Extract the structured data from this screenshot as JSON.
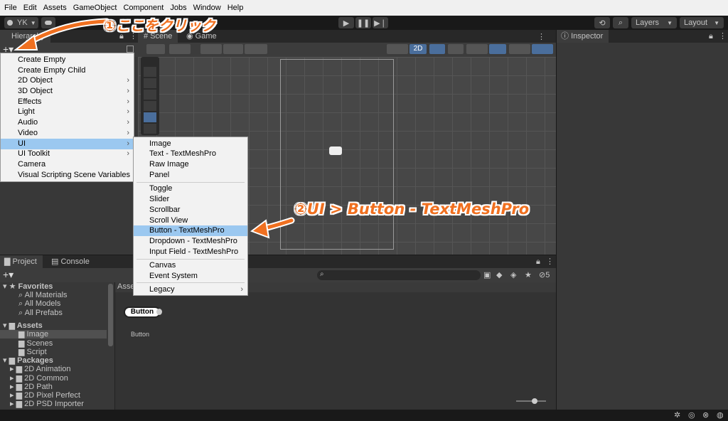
{
  "menubar": {
    "items": [
      "File",
      "Edit",
      "Assets",
      "GameObject",
      "Component",
      "Jobs",
      "Window",
      "Help"
    ]
  },
  "toolbar": {
    "account": "YK",
    "layers": "Layers",
    "layout": "Layout"
  },
  "hierarchy": {
    "tab": "Hierarchy"
  },
  "scene": {
    "tab_scene": "Scene",
    "tab_game": "Game",
    "mode_2d": "2D"
  },
  "inspector": {
    "tab": "Inspector"
  },
  "create_menu": {
    "items": [
      {
        "label": "Create Empty",
        "submenu": false
      },
      {
        "label": "Create Empty Child",
        "submenu": false
      },
      {
        "label": "2D Object",
        "submenu": true
      },
      {
        "label": "3D Object",
        "submenu": true
      },
      {
        "label": "Effects",
        "submenu": true
      },
      {
        "label": "Light",
        "submenu": true
      },
      {
        "label": "Audio",
        "submenu": true
      },
      {
        "label": "Video",
        "submenu": true
      },
      {
        "label": "UI",
        "submenu": true
      },
      {
        "label": "UI Toolkit",
        "submenu": true
      },
      {
        "label": "Camera",
        "submenu": false
      },
      {
        "label": "Visual Scripting Scene Variables",
        "submenu": false
      }
    ],
    "selected": "UI"
  },
  "ui_submenu": {
    "items": [
      "Image",
      "Text - TextMeshPro",
      "Raw Image",
      "Panel",
      "Toggle",
      "Slider",
      "Scrollbar",
      "Scroll View",
      "Button - TextMeshPro",
      "Dropdown - TextMeshPro",
      "Input Field - TextMeshPro",
      "Canvas",
      "Event System",
      "Legacy"
    ],
    "selected": "Button - TextMeshPro"
  },
  "project": {
    "tab_project": "Project",
    "tab_console": "Console",
    "breadcrumb": "Assets",
    "hidden_count": "5",
    "tree": {
      "favorites": "Favorites",
      "fav_items": [
        "All Materials",
        "All Models",
        "All Prefabs"
      ],
      "assets": "Assets",
      "asset_items": [
        "Image",
        "Scenes",
        "Script"
      ],
      "packages": "Packages",
      "package_items": [
        "2D Animation",
        "2D Common",
        "2D Path",
        "2D Pixel Perfect",
        "2D PSD Importer"
      ]
    },
    "asset_thumbnail_label": "Button",
    "asset_name": "Button"
  },
  "annotations": {
    "step1": "①ここをクリック",
    "step2": "②UI > Button - TextMeshPro"
  },
  "colors": {
    "annotation": "#f07020",
    "selection": "#9bc8f0",
    "panel": "#383838"
  }
}
